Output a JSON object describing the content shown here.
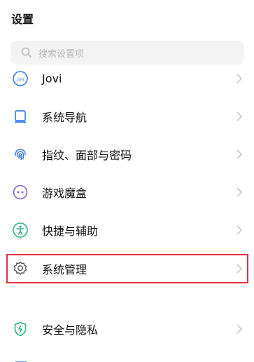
{
  "header": {
    "title": "设置"
  },
  "search": {
    "placeholder": "搜索设置项"
  },
  "menu": {
    "items": [
      {
        "label": "Jovi",
        "icon": "jovi-icon"
      },
      {
        "label": "系统导航",
        "icon": "navigation-icon"
      },
      {
        "label": "指纹、面部与密码",
        "icon": "fingerprint-icon"
      },
      {
        "label": "游戏魔盒",
        "icon": "game-box-icon"
      },
      {
        "label": "快捷与辅助",
        "icon": "accessibility-icon"
      },
      {
        "label": "系统管理",
        "icon": "gear-icon",
        "highlighted": true
      },
      {
        "label": "安全与隐私",
        "icon": "shield-icon"
      }
    ]
  },
  "colors": {
    "accent": "#3d7cf5",
    "highlight_border": "#e0323d",
    "search_bg": "#f3f3f3",
    "green": "#2bb57b",
    "purple": "#8a63d2"
  }
}
